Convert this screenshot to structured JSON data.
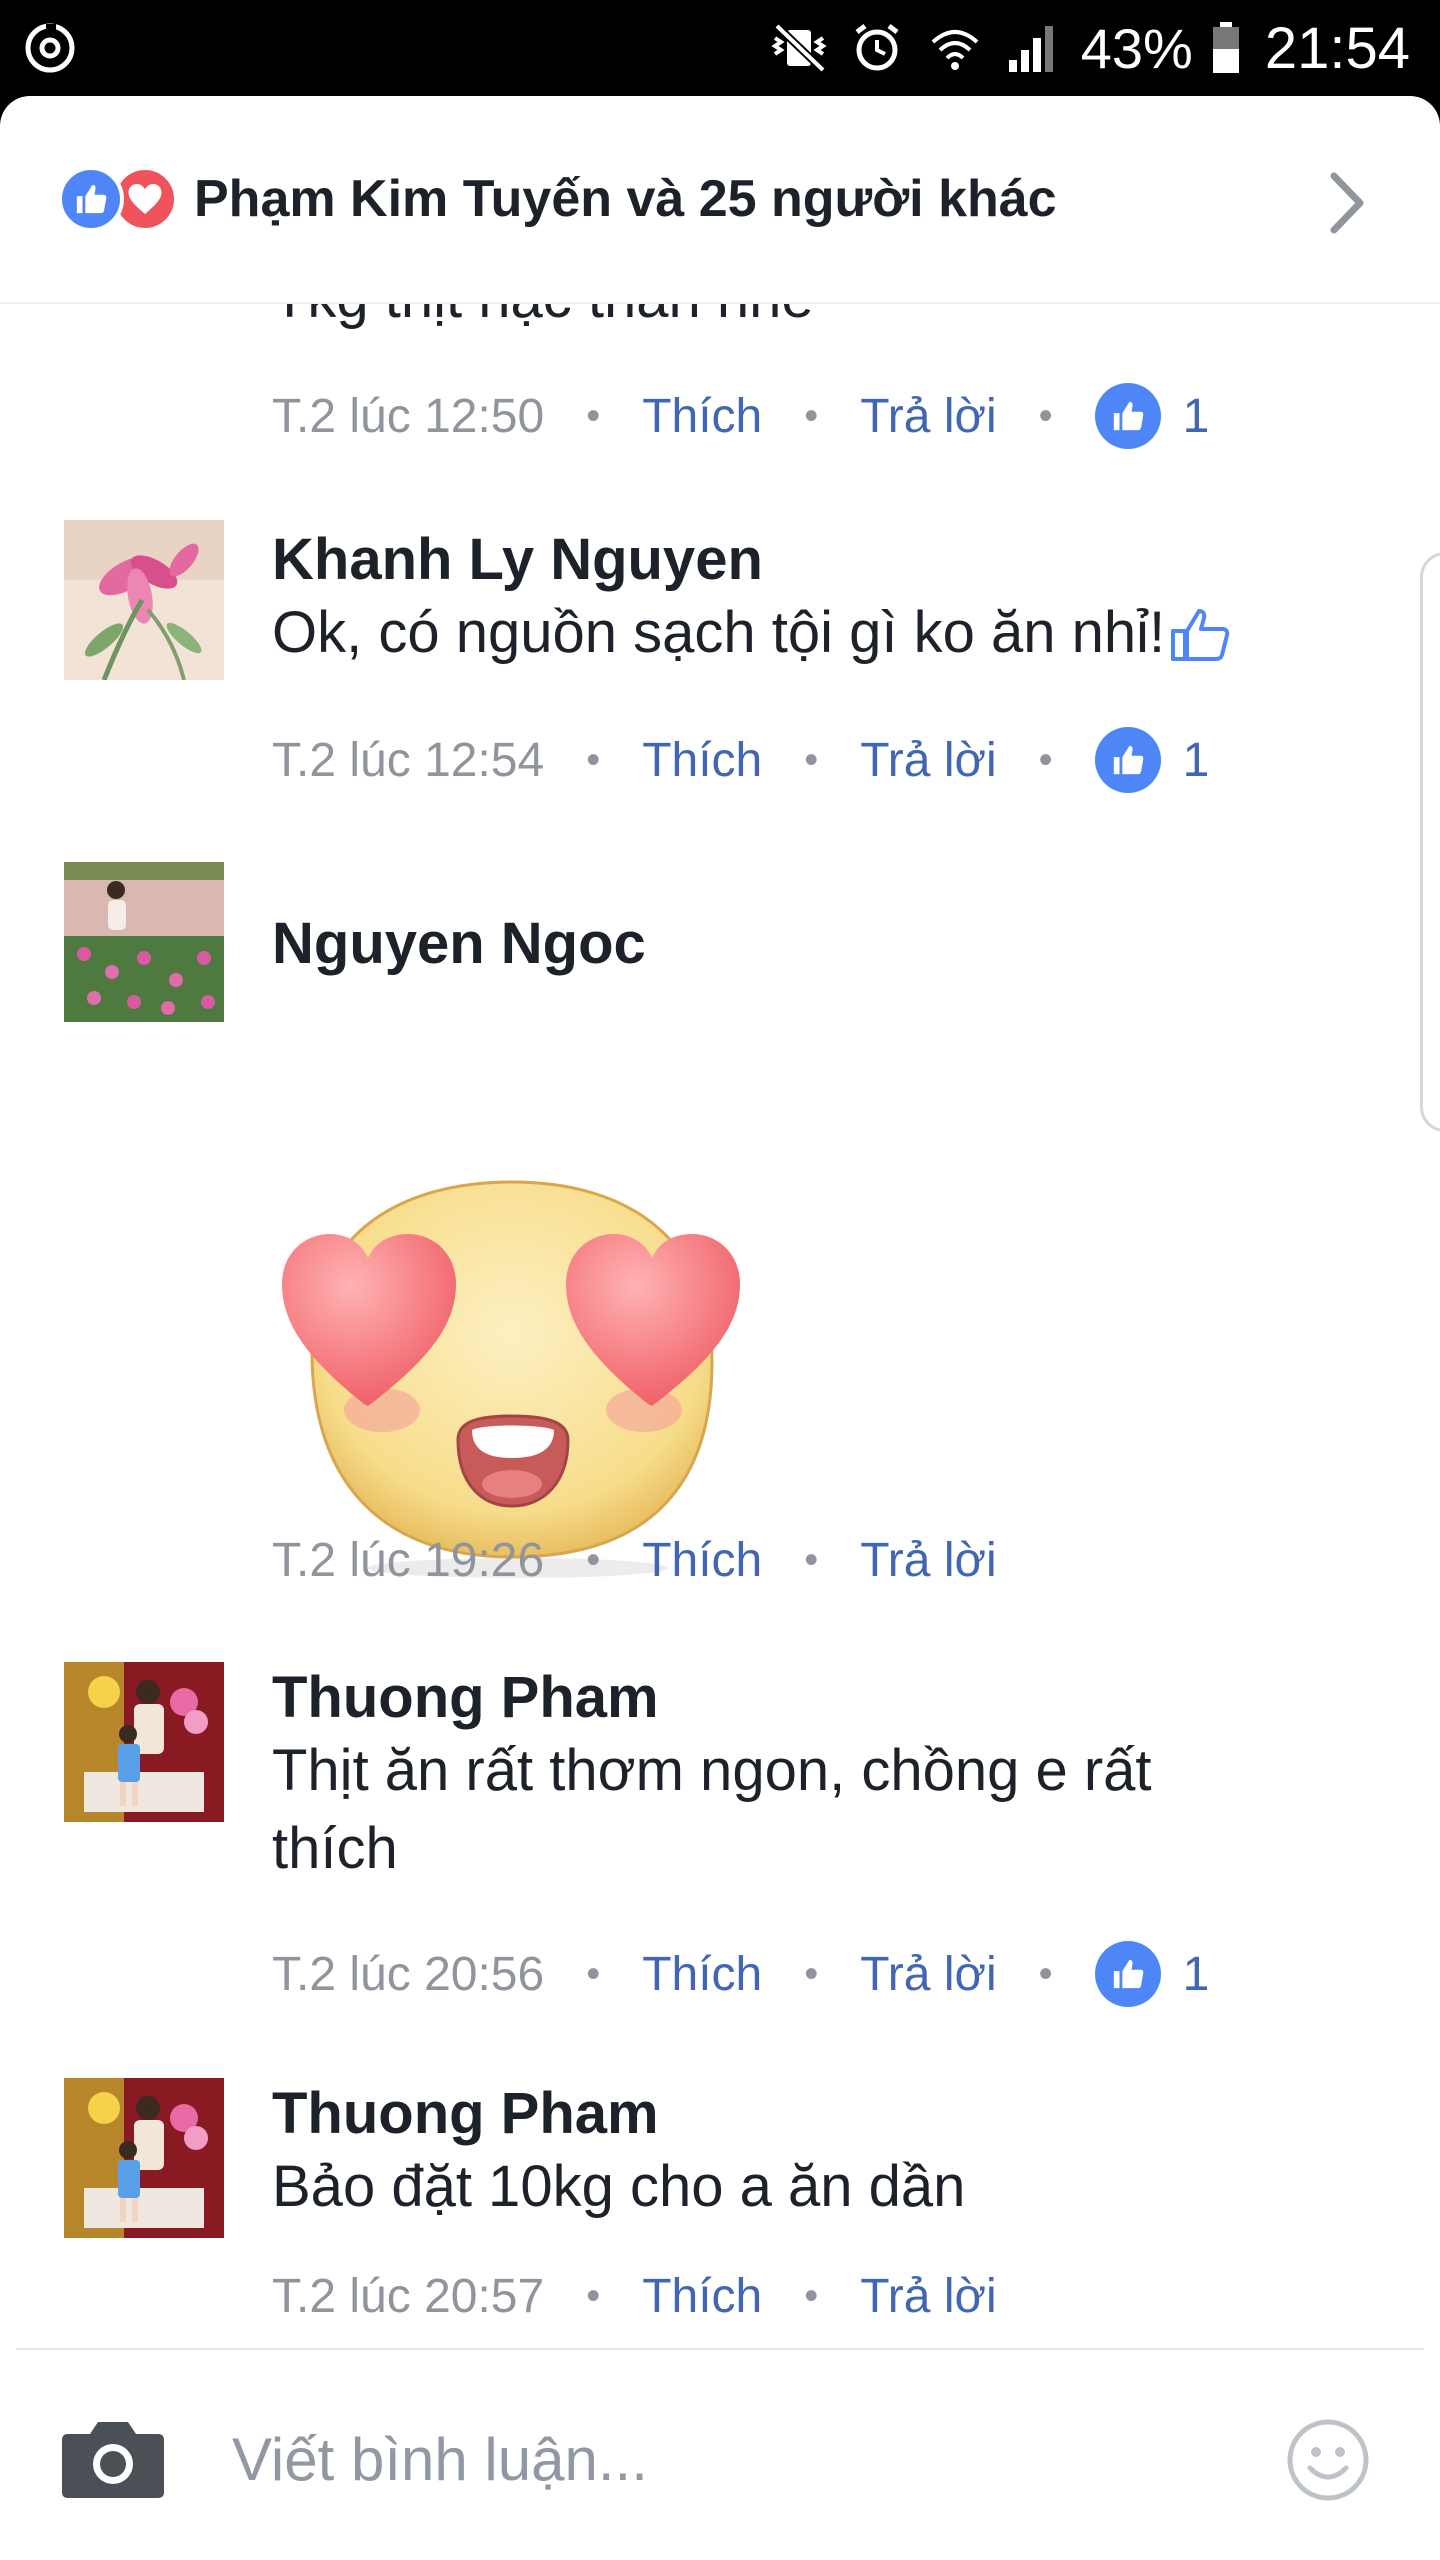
{
  "status_bar": {
    "battery": "43%",
    "time": "21:54"
  },
  "reactions": {
    "summary": "Phạm Kim Tuyến và 25 người khác",
    "icons": [
      "like-icon",
      "love-icon"
    ]
  },
  "actions": {
    "like": "Thích",
    "reply": "Trả lời"
  },
  "comments": [
    {
      "text": "Tkg thịt nạc thăn nhé",
      "time": "T.2 lúc 12:50",
      "likes": "1"
    },
    {
      "author": "Khanh Ly Nguyen",
      "text": "Ok, có nguồn sạch tội gì ko ăn nhỉ!",
      "time": "T.2 lúc 12:54",
      "likes": "1",
      "icons": [
        "thumbs-up-emoji-icon"
      ]
    },
    {
      "author": "Nguyen Ngoc",
      "sticker": "heart-eyes-sticker",
      "time": "T.2 lúc 19:26"
    },
    {
      "author": "Thuong Pham",
      "text_line1": "Thịt ăn rất thơm ngon, chồng e rất",
      "text_line2": "thích",
      "time": "T.2 lúc 20:56",
      "likes": "1"
    },
    {
      "author": "Thuong Pham",
      "text": "Bảo đặt 10kg cho a ăn dần",
      "time": "T.2 lúc 20:57"
    }
  ],
  "composer": {
    "placeholder": "Viết bình luận...",
    "icons": [
      "camera-icon",
      "emoji-icon"
    ]
  },
  "colors": {
    "like_blue": "#4f86f7",
    "link_blue": "#4267b2",
    "love_red": "#f0535b",
    "meta_gray": "#90949c"
  }
}
